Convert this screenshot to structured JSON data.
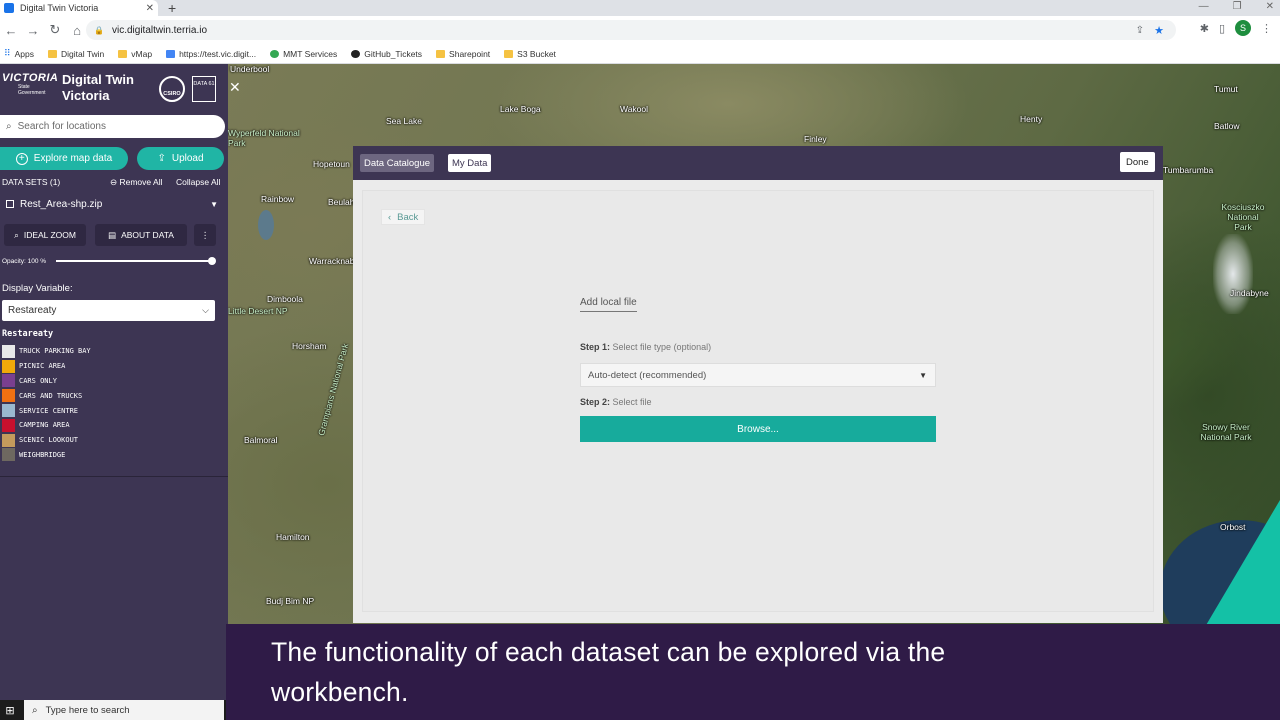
{
  "browser": {
    "tab_title": "Digital Twin Victoria",
    "tab_close": "✕",
    "new_tab": "+",
    "url": "vic.digitaltwin.terria.io",
    "profile_initial": "S",
    "bookmarks": [
      "Apps",
      "Digital Twin",
      "vMap",
      "https://test.vic.digit...",
      "MMT Services",
      "GitHub_Tickets",
      "Sharepoint",
      "S3 Bucket"
    ]
  },
  "header": {
    "logo_text": "VICTORIA",
    "logo_sub": "State Government",
    "title_line1": "Digital Twin",
    "title_line2": "Victoria",
    "csiro": "CSIRO",
    "data61": "DATA 61"
  },
  "search": {
    "placeholder": "Search for locations"
  },
  "actions": {
    "explore": "Explore map data",
    "upload": "Upload"
  },
  "workbench": {
    "count_label": "DATA SETS (1)",
    "remove_all": "Remove All",
    "collapse_all": "Collapse All",
    "dataset_name": "Rest_Area-shp.zip",
    "ideal_zoom": "IDEAL ZOOM",
    "about_data": "ABOUT DATA",
    "opacity_label": "Opacity: 100 %",
    "opacity_value": 1.0,
    "display_variable_label": "Display Variable:",
    "display_variable_value": "Restareaty",
    "legend_title": "Restareaty",
    "legend": [
      {
        "label": "TRUCK PARKING BAY",
        "color": "#e8e8e8"
      },
      {
        "label": "PICNIC AREA",
        "color": "#f0a90a"
      },
      {
        "label": "CARS ONLY",
        "color": "#7a3f8f"
      },
      {
        "label": "CARS AND TRUCKS",
        "color": "#f07012"
      },
      {
        "label": "SERVICE CENTRE",
        "color": "#9ab8cf"
      },
      {
        "label": "CAMPING AREA",
        "color": "#c8102e"
      },
      {
        "label": "SCENIC LOOKOUT",
        "color": "#c49a5c"
      },
      {
        "label": "WEIGHBRIDGE",
        "color": "#6e6860"
      }
    ]
  },
  "map_labels": [
    "Underbool",
    "Sea Lake",
    "Lake Boga",
    "Wakool",
    "Finley",
    "Henty",
    "Tumut",
    "Batlow",
    "Hopetoun",
    "Beulah",
    "Rainbow",
    "Warracknabeal",
    "Dimboola",
    "Horsham",
    "Balmoral",
    "Hamilton",
    "Budj Bim NP",
    "Orbost",
    "Jindabyne",
    "Tumbarumba",
    "Kosciuszko National Park",
    "Snowy River National Park",
    "Wyperfeld National Park",
    "Little Desert NP",
    "Grampians National Park"
  ],
  "modal": {
    "tab_catalogue": "Data Catalogue",
    "tab_my_data": "My Data",
    "done": "Done",
    "back": "Back",
    "add_local": "Add local file",
    "step1_label": "Step 1:",
    "step1_text": "Select file type (optional)",
    "file_type_value": "Auto-detect (recommended)",
    "step2_label": "Step 2:",
    "step2_text": "Select file",
    "browse": "Browse..."
  },
  "caption": {
    "line1": "The functionality of each dataset can be explored via the",
    "line2": "workbench."
  },
  "taskbar": {
    "search_placeholder": "Type here to search"
  }
}
